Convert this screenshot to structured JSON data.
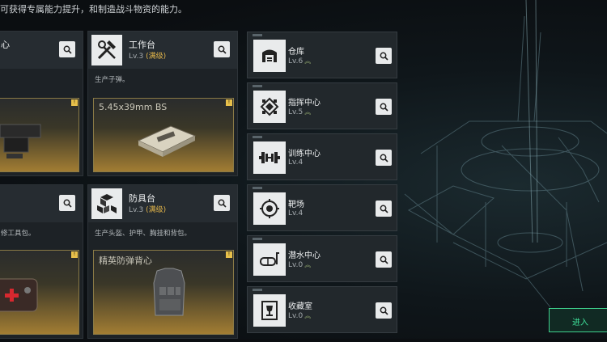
{
  "top_text": "可获得专属能力提升，和制造战斗物资的能力。",
  "left_cards": [
    {
      "title": "心",
      "level": "",
      "desc": "",
      "item": ""
    },
    {
      "title": "",
      "level": "",
      "desc": "修工具包。",
      "item": ""
    }
  ],
  "workbench": {
    "title": "工作台",
    "level": "Lv.3",
    "max": "(满级)",
    "desc": "生产子弹。",
    "item": "5.45x39mm BS",
    "badge": "!"
  },
  "armor_bench": {
    "title": "防具台",
    "level": "Lv.3",
    "max": "(满级)",
    "desc": "生产头盔、护甲、胸挂和背包。",
    "item": "精英防弹背心",
    "badge": "!"
  },
  "facilities": [
    {
      "title": "仓库",
      "level": "Lv.6",
      "icon": "warehouse-icon"
    },
    {
      "title": "指挥中心",
      "level": "Lv.5",
      "icon": "command-center-icon"
    },
    {
      "title": "训练中心",
      "level": "Lv.4",
      "icon": "dumbbell-icon"
    },
    {
      "title": "靶场",
      "level": "Lv.4",
      "icon": "target-icon"
    },
    {
      "title": "潜水中心",
      "level": "Lv.0",
      "icon": "diving-mask-icon"
    },
    {
      "title": "收藏室",
      "level": "Lv.0",
      "icon": "trophy-icon"
    }
  ],
  "enter_label": "进入",
  "colors": {
    "accent_gold": "#e2b54a",
    "accent_green": "#3fe09a"
  }
}
